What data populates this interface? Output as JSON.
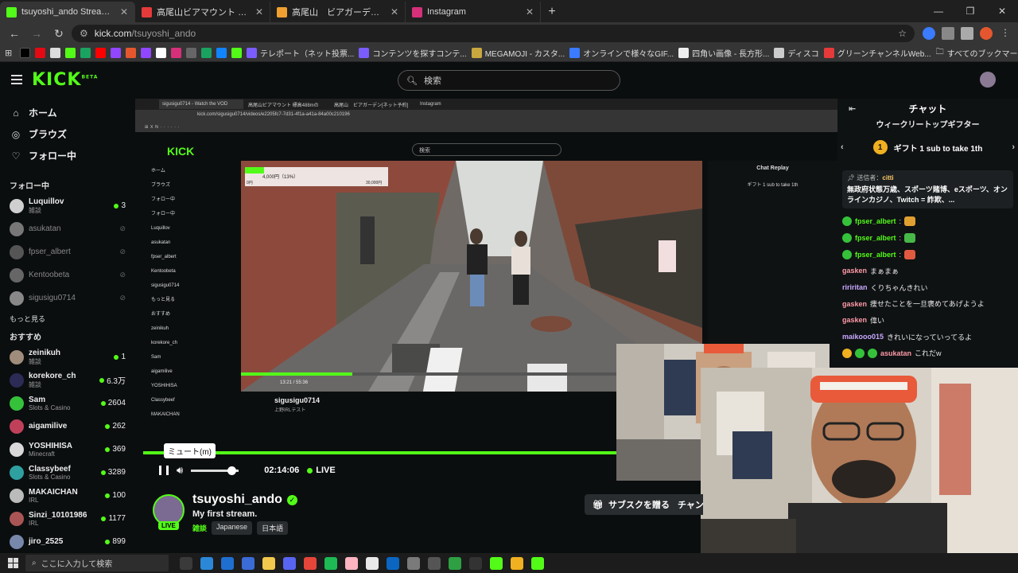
{
  "browser": {
    "tabs": [
      {
        "title": "tsuyoshi_ando Stream - Wa",
        "icon": "kick-icon",
        "color": "#53fc18",
        "active": true
      },
      {
        "title": "高尾山ビアマウント 標高488mのビ",
        "icon": "u-icon",
        "color": "#e63a3a",
        "active": false
      },
      {
        "title": "高尾山　ビアガーデン[ネット予約]",
        "icon": "site-icon",
        "color": "#f0a030",
        "active": false
      },
      {
        "title": "Instagram",
        "icon": "instagram-icon",
        "color": "#d6307a",
        "active": false
      }
    ],
    "url_host": "kick.com",
    "url_path": "/tsuyoshi_ando",
    "bookmarks": [
      {
        "label": "テレポート（ネット投票...",
        "color": "#7a5cff"
      },
      {
        "label": "コンテンツを探すコンテ...",
        "color": "#7a5cff"
      },
      {
        "label": "MEGAMOJI - カスタ...",
        "color": "#c9a640"
      },
      {
        "label": "オンラインで様々なGIF...",
        "color": "#3a7bff"
      },
      {
        "label": "四角い画像 - 長方形...",
        "color": "#eeeeee"
      },
      {
        "label": "ディスコ",
        "color": "#cccccc"
      },
      {
        "label": "グリーンチャンネルWeb...",
        "color": "#e63a3a"
      }
    ],
    "all_bookmarks": "すべてのブックマーク"
  },
  "kick": {
    "logo": "KICK",
    "logo_sup": "BETA",
    "search_placeholder": "検索"
  },
  "sidebar": {
    "nav": [
      {
        "label": "ホーム",
        "icon": "home-icon",
        "glyph": "⌂"
      },
      {
        "label": "ブラウズ",
        "icon": "compass-icon",
        "glyph": "◎"
      },
      {
        "label": "フォロー中",
        "icon": "heart-icon",
        "glyph": "♡"
      }
    ],
    "following_title": "フォロー中",
    "following": [
      {
        "name": "Luquillov",
        "category": "雑談",
        "count": "3",
        "live": true,
        "color": "#cfcfcf"
      },
      {
        "name": "asukatan",
        "category": "",
        "count": "",
        "live": false,
        "color": "#777777"
      },
      {
        "name": "fpser_albert",
        "category": "",
        "count": "",
        "live": false,
        "color": "#555555"
      },
      {
        "name": "Kentoobeta",
        "category": "",
        "count": "",
        "live": false,
        "color": "#666666"
      },
      {
        "name": "sigusigu0714",
        "category": "",
        "count": "",
        "live": false,
        "color": "#888888"
      }
    ],
    "more_label": "もっと見る",
    "recommended_title": "おすすめ",
    "recommended": [
      {
        "name": "zeinikuh",
        "category": "雑談",
        "count": "1",
        "color": "#a08c7a"
      },
      {
        "name": "korekore_ch",
        "category": "雑談",
        "count": "6.3万",
        "color": "#2b2b55"
      },
      {
        "name": "Sam",
        "category": "Slots & Casino",
        "count": "2604",
        "color": "#35c23a"
      },
      {
        "name": "aigamilive",
        "category": "",
        "count": "262",
        "color": "#c0405a"
      },
      {
        "name": "YOSHIHISA",
        "category": "Minecraft",
        "count": "369",
        "color": "#d9d9d9"
      },
      {
        "name": "Classybeef",
        "category": "Slots & Casino",
        "count": "3289",
        "color": "#2fa0a0"
      },
      {
        "name": "MAKAICHAN",
        "category": "IRL",
        "count": "100",
        "color": "#bbbbbb"
      },
      {
        "name": "Sinzi_10101986",
        "category": "IRL",
        "count": "1177",
        "color": "#aa5555"
      },
      {
        "name": "jiro_2525",
        "category": "",
        "count": "899",
        "color": "#7788aa"
      }
    ]
  },
  "nested": {
    "tabs": [
      "sigusigu0714 - Watch the VOD",
      "高尾山ビアマウント 標高488mの",
      "高尾山　ビアガーデン[ネット予約]",
      "Instagram"
    ],
    "url": "kick.com/sigusigu0714/videos/e2205fc7-7d31-4f1a-a41a-84a00c210196",
    "sidebar": [
      "ホーム",
      "ブラウズ",
      "フォロー中",
      "フォロー中",
      "Luquillov",
      "asukatan",
      "fpser_albert",
      "Kentoobeta",
      "sigusigu0714",
      "もっと見る",
      "おすすめ",
      "zeinikuh",
      "korekore_ch",
      "Sam",
      "aigamilive",
      "YOSHIHISA",
      "Classybeef",
      "MAKAICHAN"
    ],
    "chat_title": "Chat Replay",
    "chat_gift": "ギフト 1 sub to take 1th",
    "overlay_amount": "4,000円（13%）",
    "overlay_left": "0円",
    "overlay_right": "30,000円",
    "video_time": "13:21 / 55:36",
    "streamer": "sigusigu0714",
    "stream_title": "上野IRLテスト",
    "tags": [
      "IRL",
      "Japanese",
      "English",
      "game",
      "irl",
      "kawaii"
    ]
  },
  "player": {
    "tooltip": "ミュート(m)",
    "time": "02:14:06",
    "live": "LIVE",
    "volume": 0.85
  },
  "chat": {
    "title": "チャット",
    "subtitle": "ウィークリートップギフター",
    "gift_count": "1",
    "gift_text": "ギフト 1 sub to take 1th",
    "pinned_prefix": "送信者：",
    "pinned_user": "citti",
    "pinned_text": "無政府状態万歳、スポーツ賭博、eスポーツ、オンラインカジノ、Twitch = 詐欺、...",
    "messages": [
      {
        "user": "fpser_albert",
        "text": ":",
        "color": "#53fc18",
        "badge": "green",
        "emote": "#e0a030"
      },
      {
        "user": "fpser_albert",
        "text": ":",
        "color": "#53fc18",
        "badge": "green",
        "emote": "#47b847"
      },
      {
        "user": "fpser_albert",
        "text": ":",
        "color": "#53fc18",
        "badge": "green",
        "emote": "#e05a40"
      },
      {
        "user": "gasken",
        "text": "まぁまぁ",
        "color": "#ff9aa8",
        "badge": "",
        "emote": ""
      },
      {
        "user": "ririritan",
        "text": "くりちゃんきれい",
        "color": "#c7a8ff",
        "badge": "",
        "emote": ""
      },
      {
        "user": "gasken",
        "text": "痩せたことを一旦褒めてあげようよ",
        "color": "#ff9aa8",
        "badge": "",
        "emote": ""
      },
      {
        "user": "gasken",
        "text": "偉い",
        "color": "#ff9aa8",
        "badge": "",
        "emote": ""
      },
      {
        "user": "maikooo015",
        "text": "きれいになっていってるよ",
        "color": "#c7a8ff",
        "badge": "",
        "emote": ""
      },
      {
        "user": "asukatan",
        "text": "これだw",
        "color": "#ff9aa8",
        "badge": "multi",
        "emote": ""
      }
    ]
  },
  "streamer": {
    "name": "tsuyoshi_ando",
    "live_badge": "LIVE",
    "title": "My first stream.",
    "category": "雑談",
    "tags": [
      "Japanese",
      "日本語"
    ],
    "subscribe": "サブスクを贈る",
    "channel": "チャン"
  },
  "taskbar": {
    "search_placeholder": "ここに入力して検索",
    "apps": [
      "#3a3a3a",
      "#2b88d8",
      "#1f6fd1",
      "#3b6bd6",
      "#f2c94c",
      "#5865f2",
      "#e6453a",
      "#1db954",
      "#ffb3c1",
      "#e8e8e8",
      "#0a66c2",
      "#7a7a7a",
      "#555555",
      "#2ea043",
      "#333333",
      "#53fc18",
      "#f0b020",
      "#53fc18"
    ]
  }
}
